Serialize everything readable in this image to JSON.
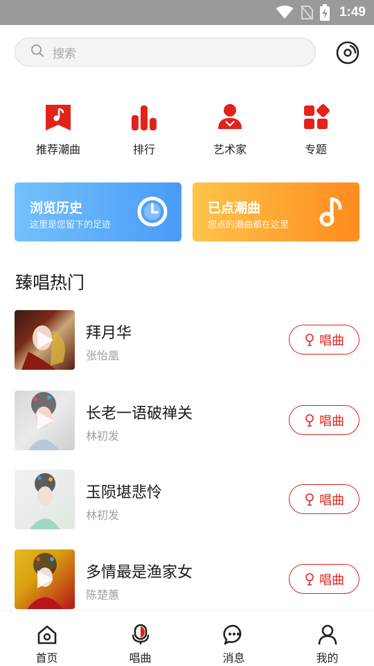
{
  "status_bar": {
    "time": "1:49",
    "icons": [
      "wifi-icon",
      "no-sim-icon",
      "battery-charging-icon"
    ]
  },
  "search": {
    "placeholder": "搜索"
  },
  "categories": [
    {
      "label": "推荐潮曲",
      "icon": "music-note-bookmark-icon"
    },
    {
      "label": "排行",
      "icon": "bar-chart-icon"
    },
    {
      "label": "艺术家",
      "icon": "person-icon"
    },
    {
      "label": "专题",
      "icon": "grid-squares-icon"
    }
  ],
  "banners": [
    {
      "title": "浏览历史",
      "subtitle": "这里是您留下的足迹",
      "icon": "clock-icon",
      "color": "#4a9bf8"
    },
    {
      "title": "已点潮曲",
      "subtitle": "您点的潮曲都在这里",
      "icon": "music-note-icon",
      "color": "#ff8b1e"
    }
  ],
  "section_title": "臻唱热门",
  "songs": [
    {
      "title": "拜月华",
      "artist": "张怡凰",
      "button": "唱曲"
    },
    {
      "title": "长老一语破禅关",
      "artist": "林初发",
      "button": "唱曲"
    },
    {
      "title": "玉陨堪悲怜",
      "artist": "林初发",
      "button": "唱曲"
    },
    {
      "title": "多情最是渔家女",
      "artist": "陈楚蕙",
      "button": "唱曲"
    }
  ],
  "bottom_nav": [
    {
      "label": "首页",
      "icon": "home-icon"
    },
    {
      "label": "唱曲",
      "icon": "microphone-icon",
      "active": true
    },
    {
      "label": "消息",
      "icon": "chat-bubble-icon"
    },
    {
      "label": "我的",
      "icon": "user-icon"
    }
  ],
  "colors": {
    "accent": "#e2231a",
    "blue": "#4a9bf8",
    "orange": "#ff8b1e"
  }
}
